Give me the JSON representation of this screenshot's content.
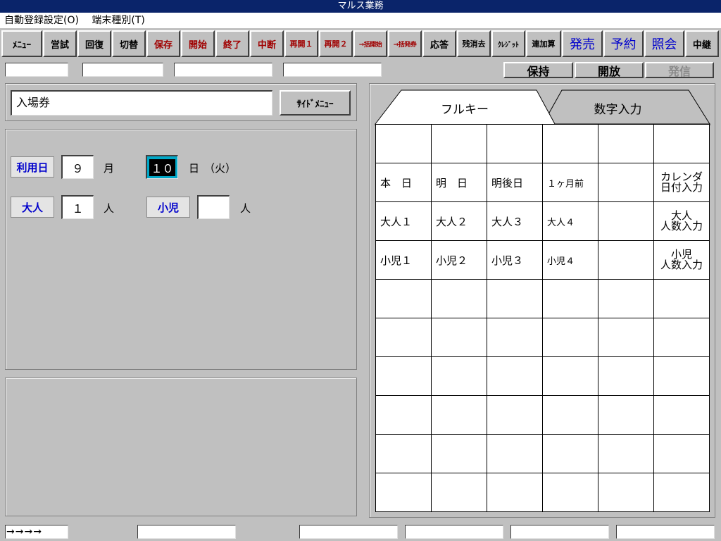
{
  "title": "マルス業務",
  "menu": [
    "自動登録設定(O)",
    "端末種別(T)"
  ],
  "toolbar": [
    "ﾒﾆｭｰ",
    "営試",
    "回復",
    "切替",
    "保存",
    "開始",
    "終了",
    "中断",
    "再開１",
    "再開２",
    "→括開始",
    "→括発券",
    "応答",
    "残消去",
    "ｸﾚｼﾞｯﾄ",
    "連加算",
    "発売",
    "予約",
    "照会",
    "中継"
  ],
  "actions": {
    "hold": "保持",
    "release": "開放",
    "send": "発信"
  },
  "ticket_type": "入場券",
  "side_menu": "ｻｲﾄﾞﾒﾆｭｰ",
  "form": {
    "use_date_label": "利用日",
    "month_value": "９",
    "month_unit": "月",
    "day_value": "１０",
    "day_unit": "日",
    "weekday": "（火）",
    "adult_label": "大人",
    "adult_value": "１",
    "adult_unit": "人",
    "child_label": "小児",
    "child_value": "",
    "child_unit": "人"
  },
  "tabs": {
    "full_key": "フルキー",
    "numeric": "数字入力"
  },
  "keypad": [
    [
      "",
      "",
      "",
      "",
      "",
      ""
    ],
    [
      "本　日",
      "明　日",
      "明後日",
      "１ヶ月前",
      "",
      "カレンダ\n日付入力"
    ],
    [
      "大人１",
      "大人２",
      "大人３",
      "大人４",
      "",
      "大人\n人数入力"
    ],
    [
      "小児１",
      "小児２",
      "小児３",
      "小児４",
      "",
      "小児\n人数入力"
    ],
    [
      "",
      "",
      "",
      "",
      "",
      ""
    ],
    [
      "",
      "",
      "",
      "",
      "",
      ""
    ],
    [
      "",
      "",
      "",
      "",
      "",
      ""
    ],
    [
      "",
      "",
      "",
      "",
      "",
      ""
    ],
    [
      "",
      "",
      "",
      "",
      "",
      ""
    ],
    [
      "",
      "",
      "",
      "",
      "",
      ""
    ]
  ],
  "status": {
    "arrows": "→→→→"
  }
}
